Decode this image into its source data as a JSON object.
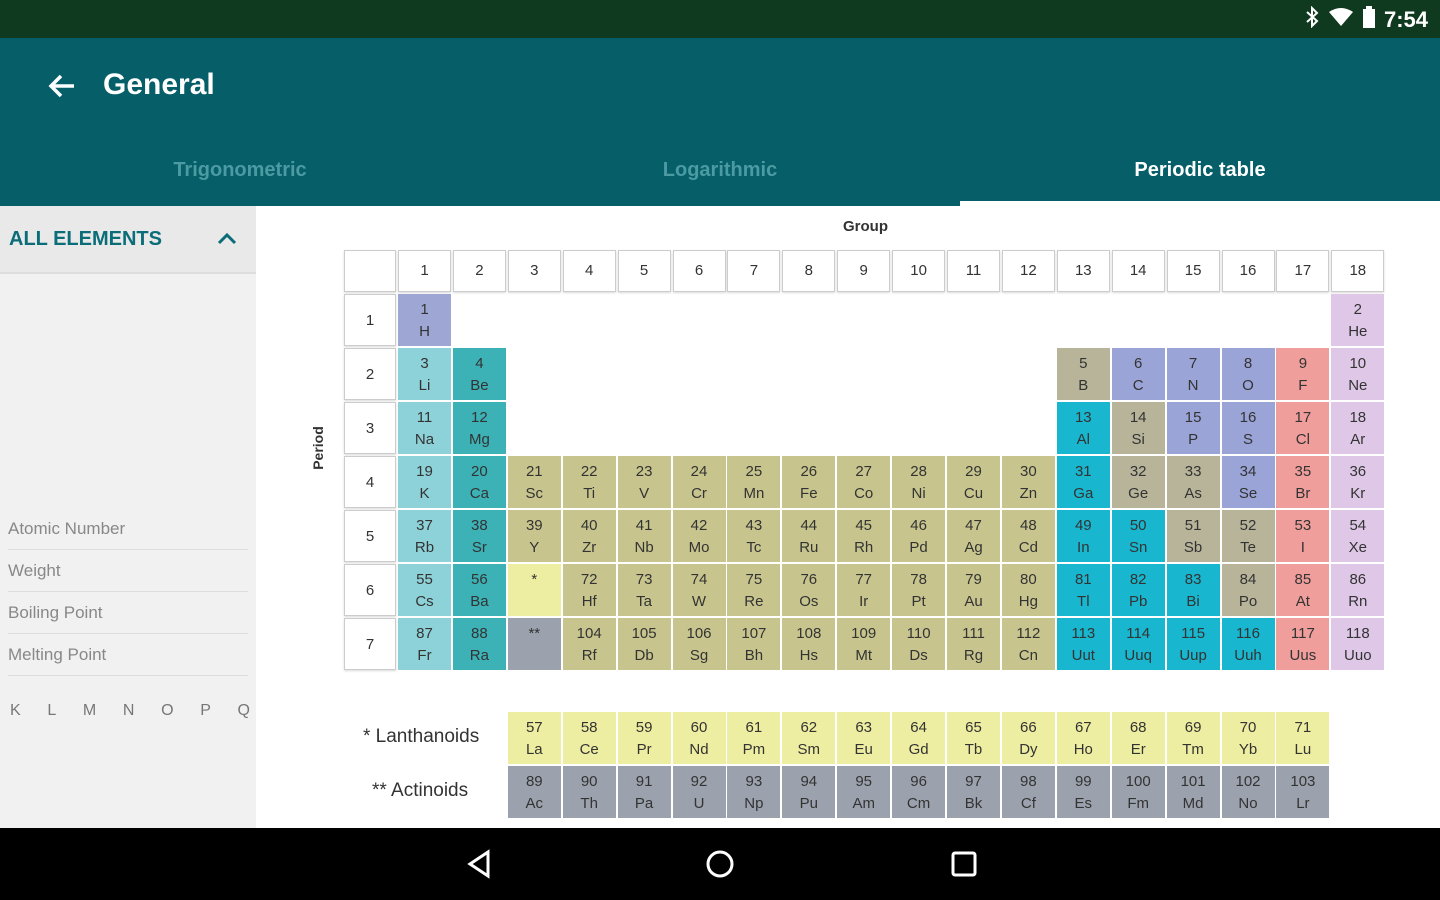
{
  "status_bar": {
    "time": "7:54",
    "icons": [
      "bluetooth-icon",
      "wifi-icon",
      "battery-icon"
    ]
  },
  "app_bar": {
    "title": "General",
    "back_icon": "arrow-back-icon"
  },
  "tabs": [
    {
      "label": "Trigonometric",
      "active": false
    },
    {
      "label": "Logarithmic",
      "active": false
    },
    {
      "label": "Periodic table",
      "active": true
    }
  ],
  "sidebar": {
    "header": "ALL ELEMENTS",
    "items": [
      "Atomic Number",
      "Weight",
      "Boiling Point",
      "Melting Point"
    ],
    "shells": [
      "K",
      "L",
      "M",
      "N",
      "O",
      "P",
      "Q"
    ]
  },
  "table": {
    "group_label": "Group",
    "period_label": "Period",
    "groups": [
      "1",
      "2",
      "3",
      "4",
      "5",
      "6",
      "7",
      "8",
      "9",
      "10",
      "11",
      "12",
      "13",
      "14",
      "15",
      "16",
      "17",
      "18"
    ],
    "periods": [
      "1",
      "2",
      "3",
      "4",
      "5",
      "6",
      "7"
    ],
    "lanthanoids_label": "* Lanthanoids",
    "actinoids_label": "** Actinoids",
    "colors": {
      "hydrogen": "#9ea6d4",
      "alkali": "#8dd2d8",
      "alkaline": "#3cb2b6",
      "transition": "#c7c58d",
      "metal13": "#18b6cf",
      "metalloid": "#b7b49a",
      "nonmetal": "#9aa4d7",
      "halogen": "#ef9e9b",
      "noble": "#dfc8e7",
      "lanth": "#eeeea2",
      "actin": "#9ba2ad"
    },
    "elements": [
      {
        "n": "1",
        "s": "H",
        "p": 1,
        "g": 1,
        "c": "hydrogen"
      },
      {
        "n": "2",
        "s": "He",
        "p": 1,
        "g": 18,
        "c": "noble"
      },
      {
        "n": "3",
        "s": "Li",
        "p": 2,
        "g": 1,
        "c": "alkali"
      },
      {
        "n": "4",
        "s": "Be",
        "p": 2,
        "g": 2,
        "c": "alkaline"
      },
      {
        "n": "5",
        "s": "B",
        "p": 2,
        "g": 13,
        "c": "metalloid"
      },
      {
        "n": "6",
        "s": "C",
        "p": 2,
        "g": 14,
        "c": "nonmetal"
      },
      {
        "n": "7",
        "s": "N",
        "p": 2,
        "g": 15,
        "c": "nonmetal"
      },
      {
        "n": "8",
        "s": "O",
        "p": 2,
        "g": 16,
        "c": "nonmetal"
      },
      {
        "n": "9",
        "s": "F",
        "p": 2,
        "g": 17,
        "c": "halogen"
      },
      {
        "n": "10",
        "s": "Ne",
        "p": 2,
        "g": 18,
        "c": "noble"
      },
      {
        "n": "11",
        "s": "Na",
        "p": 3,
        "g": 1,
        "c": "alkali"
      },
      {
        "n": "12",
        "s": "Mg",
        "p": 3,
        "g": 2,
        "c": "alkaline"
      },
      {
        "n": "13",
        "s": "Al",
        "p": 3,
        "g": 13,
        "c": "metal13"
      },
      {
        "n": "14",
        "s": "Si",
        "p": 3,
        "g": 14,
        "c": "metalloid"
      },
      {
        "n": "15",
        "s": "P",
        "p": 3,
        "g": 15,
        "c": "nonmetal"
      },
      {
        "n": "16",
        "s": "S",
        "p": 3,
        "g": 16,
        "c": "nonmetal"
      },
      {
        "n": "17",
        "s": "Cl",
        "p": 3,
        "g": 17,
        "c": "halogen"
      },
      {
        "n": "18",
        "s": "Ar",
        "p": 3,
        "g": 18,
        "c": "noble"
      },
      {
        "n": "19",
        "s": "K",
        "p": 4,
        "g": 1,
        "c": "alkali"
      },
      {
        "n": "20",
        "s": "Ca",
        "p": 4,
        "g": 2,
        "c": "alkaline"
      },
      {
        "n": "21",
        "s": "Sc",
        "p": 4,
        "g": 3,
        "c": "transition"
      },
      {
        "n": "22",
        "s": "Ti",
        "p": 4,
        "g": 4,
        "c": "transition"
      },
      {
        "n": "23",
        "s": "V",
        "p": 4,
        "g": 5,
        "c": "transition"
      },
      {
        "n": "24",
        "s": "Cr",
        "p": 4,
        "g": 6,
        "c": "transition"
      },
      {
        "n": "25",
        "s": "Mn",
        "p": 4,
        "g": 7,
        "c": "transition"
      },
      {
        "n": "26",
        "s": "Fe",
        "p": 4,
        "g": 8,
        "c": "transition"
      },
      {
        "n": "27",
        "s": "Co",
        "p": 4,
        "g": 9,
        "c": "transition"
      },
      {
        "n": "28",
        "s": "Ni",
        "p": 4,
        "g": 10,
        "c": "transition"
      },
      {
        "n": "29",
        "s": "Cu",
        "p": 4,
        "g": 11,
        "c": "transition"
      },
      {
        "n": "30",
        "s": "Zn",
        "p": 4,
        "g": 12,
        "c": "transition"
      },
      {
        "n": "31",
        "s": "Ga",
        "p": 4,
        "g": 13,
        "c": "metal13"
      },
      {
        "n": "32",
        "s": "Ge",
        "p": 4,
        "g": 14,
        "c": "metalloid"
      },
      {
        "n": "33",
        "s": "As",
        "p": 4,
        "g": 15,
        "c": "metalloid"
      },
      {
        "n": "34",
        "s": "Se",
        "p": 4,
        "g": 16,
        "c": "nonmetal"
      },
      {
        "n": "35",
        "s": "Br",
        "p": 4,
        "g": 17,
        "c": "halogen"
      },
      {
        "n": "36",
        "s": "Kr",
        "p": 4,
        "g": 18,
        "c": "noble"
      },
      {
        "n": "37",
        "s": "Rb",
        "p": 5,
        "g": 1,
        "c": "alkali"
      },
      {
        "n": "38",
        "s": "Sr",
        "p": 5,
        "g": 2,
        "c": "alkaline"
      },
      {
        "n": "39",
        "s": "Y",
        "p": 5,
        "g": 3,
        "c": "transition"
      },
      {
        "n": "40",
        "s": "Zr",
        "p": 5,
        "g": 4,
        "c": "transition"
      },
      {
        "n": "41",
        "s": "Nb",
        "p": 5,
        "g": 5,
        "c": "transition"
      },
      {
        "n": "42",
        "s": "Mo",
        "p": 5,
        "g": 6,
        "c": "transition"
      },
      {
        "n": "43",
        "s": "Tc",
        "p": 5,
        "g": 7,
        "c": "transition"
      },
      {
        "n": "44",
        "s": "Ru",
        "p": 5,
        "g": 8,
        "c": "transition"
      },
      {
        "n": "45",
        "s": "Rh",
        "p": 5,
        "g": 9,
        "c": "transition"
      },
      {
        "n": "46",
        "s": "Pd",
        "p": 5,
        "g": 10,
        "c": "transition"
      },
      {
        "n": "47",
        "s": "Ag",
        "p": 5,
        "g": 11,
        "c": "transition"
      },
      {
        "n": "48",
        "s": "Cd",
        "p": 5,
        "g": 12,
        "c": "transition"
      },
      {
        "n": "49",
        "s": "In",
        "p": 5,
        "g": 13,
        "c": "metal13"
      },
      {
        "n": "50",
        "s": "Sn",
        "p": 5,
        "g": 14,
        "c": "metal13"
      },
      {
        "n": "51",
        "s": "Sb",
        "p": 5,
        "g": 15,
        "c": "metalloid"
      },
      {
        "n": "52",
        "s": "Te",
        "p": 5,
        "g": 16,
        "c": "metalloid"
      },
      {
        "n": "53",
        "s": "I",
        "p": 5,
        "g": 17,
        "c": "halogen"
      },
      {
        "n": "54",
        "s": "Xe",
        "p": 5,
        "g": 18,
        "c": "noble"
      },
      {
        "n": "55",
        "s": "Cs",
        "p": 6,
        "g": 1,
        "c": "alkali"
      },
      {
        "n": "56",
        "s": "Ba",
        "p": 6,
        "g": 2,
        "c": "alkaline"
      },
      {
        "n": "*",
        "s": "",
        "p": 6,
        "g": 3,
        "c": "lanth"
      },
      {
        "n": "72",
        "s": "Hf",
        "p": 6,
        "g": 4,
        "c": "transition"
      },
      {
        "n": "73",
        "s": "Ta",
        "p": 6,
        "g": 5,
        "c": "transition"
      },
      {
        "n": "74",
        "s": "W",
        "p": 6,
        "g": 6,
        "c": "transition"
      },
      {
        "n": "75",
        "s": "Re",
        "p": 6,
        "g": 7,
        "c": "transition"
      },
      {
        "n": "76",
        "s": "Os",
        "p": 6,
        "g": 8,
        "c": "transition"
      },
      {
        "n": "77",
        "s": "Ir",
        "p": 6,
        "g": 9,
        "c": "transition"
      },
      {
        "n": "78",
        "s": "Pt",
        "p": 6,
        "g": 10,
        "c": "transition"
      },
      {
        "n": "79",
        "s": "Au",
        "p": 6,
        "g": 11,
        "c": "transition"
      },
      {
        "n": "80",
        "s": "Hg",
        "p": 6,
        "g": 12,
        "c": "transition"
      },
      {
        "n": "81",
        "s": "Tl",
        "p": 6,
        "g": 13,
        "c": "metal13"
      },
      {
        "n": "82",
        "s": "Pb",
        "p": 6,
        "g": 14,
        "c": "metal13"
      },
      {
        "n": "83",
        "s": "Bi",
        "p": 6,
        "g": 15,
        "c": "metal13"
      },
      {
        "n": "84",
        "s": "Po",
        "p": 6,
        "g": 16,
        "c": "metalloid"
      },
      {
        "n": "85",
        "s": "At",
        "p": 6,
        "g": 17,
        "c": "halogen"
      },
      {
        "n": "86",
        "s": "Rn",
        "p": 6,
        "g": 18,
        "c": "noble"
      },
      {
        "n": "87",
        "s": "Fr",
        "p": 7,
        "g": 1,
        "c": "alkali"
      },
      {
        "n": "88",
        "s": "Ra",
        "p": 7,
        "g": 2,
        "c": "alkaline"
      },
      {
        "n": "**",
        "s": "",
        "p": 7,
        "g": 3,
        "c": "actin"
      },
      {
        "n": "104",
        "s": "Rf",
        "p": 7,
        "g": 4,
        "c": "transition"
      },
      {
        "n": "105",
        "s": "Db",
        "p": 7,
        "g": 5,
        "c": "transition"
      },
      {
        "n": "106",
        "s": "Sg",
        "p": 7,
        "g": 6,
        "c": "transition"
      },
      {
        "n": "107",
        "s": "Bh",
        "p": 7,
        "g": 7,
        "c": "transition"
      },
      {
        "n": "108",
        "s": "Hs",
        "p": 7,
        "g": 8,
        "c": "transition"
      },
      {
        "n": "109",
        "s": "Mt",
        "p": 7,
        "g": 9,
        "c": "transition"
      },
      {
        "n": "110",
        "s": "Ds",
        "p": 7,
        "g": 10,
        "c": "transition"
      },
      {
        "n": "111",
        "s": "Rg",
        "p": 7,
        "g": 11,
        "c": "transition"
      },
      {
        "n": "112",
        "s": "Cn",
        "p": 7,
        "g": 12,
        "c": "transition"
      },
      {
        "n": "113",
        "s": "Uut",
        "p": 7,
        "g": 13,
        "c": "metal13"
      },
      {
        "n": "114",
        "s": "Uuq",
        "p": 7,
        "g": 14,
        "c": "metal13"
      },
      {
        "n": "115",
        "s": "Uup",
        "p": 7,
        "g": 15,
        "c": "metal13"
      },
      {
        "n": "116",
        "s": "Uuh",
        "p": 7,
        "g": 16,
        "c": "metal13"
      },
      {
        "n": "117",
        "s": "Uus",
        "p": 7,
        "g": 17,
        "c": "halogen"
      },
      {
        "n": "118",
        "s": "Uuo",
        "p": 7,
        "g": 18,
        "c": "noble"
      }
    ],
    "lanthanoids": [
      {
        "n": "57",
        "s": "La"
      },
      {
        "n": "58",
        "s": "Ce"
      },
      {
        "n": "59",
        "s": "Pr"
      },
      {
        "n": "60",
        "s": "Nd"
      },
      {
        "n": "61",
        "s": "Pm"
      },
      {
        "n": "62",
        "s": "Sm"
      },
      {
        "n": "63",
        "s": "Eu"
      },
      {
        "n": "64",
        "s": "Gd"
      },
      {
        "n": "65",
        "s": "Tb"
      },
      {
        "n": "66",
        "s": "Dy"
      },
      {
        "n": "67",
        "s": "Ho"
      },
      {
        "n": "68",
        "s": "Er"
      },
      {
        "n": "69",
        "s": "Tm"
      },
      {
        "n": "70",
        "s": "Yb"
      },
      {
        "n": "71",
        "s": "Lu"
      }
    ],
    "actinoids": [
      {
        "n": "89",
        "s": "Ac"
      },
      {
        "n": "90",
        "s": "Th"
      },
      {
        "n": "91",
        "s": "Pa"
      },
      {
        "n": "92",
        "s": "U"
      },
      {
        "n": "93",
        "s": "Np"
      },
      {
        "n": "94",
        "s": "Pu"
      },
      {
        "n": "95",
        "s": "Am"
      },
      {
        "n": "96",
        "s": "Cm"
      },
      {
        "n": "97",
        "s": "Bk"
      },
      {
        "n": "98",
        "s": "Cf"
      },
      {
        "n": "99",
        "s": "Es"
      },
      {
        "n": "100",
        "s": "Fm"
      },
      {
        "n": "101",
        "s": "Md"
      },
      {
        "n": "102",
        "s": "No"
      },
      {
        "n": "103",
        "s": "Lr"
      }
    ]
  },
  "nav_bar": {
    "icons": [
      "back-triangle-icon",
      "home-circle-icon",
      "recents-square-icon"
    ]
  }
}
